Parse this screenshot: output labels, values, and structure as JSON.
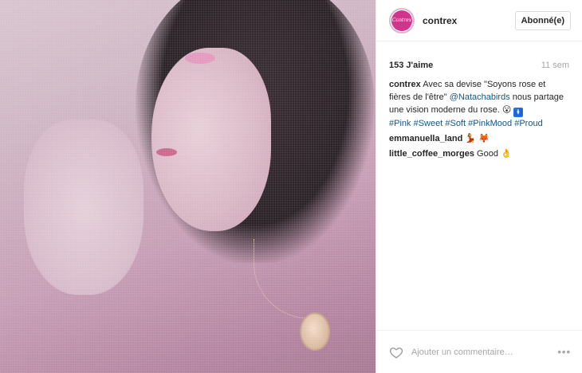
{
  "account": {
    "username": "contrex",
    "avatar_text": "Contrex",
    "follow_label": "Abonné(e)"
  },
  "post": {
    "likes": "153 J'aime",
    "age": "11 sem"
  },
  "caption": {
    "user": "contrex",
    "text_before_mention": "Avec sa devise \"Soyons rose et fières de l'être\"",
    "mention": "@Natachabirds",
    "text_after_mention": "nous partage une vision moderne du rose.",
    "emoji_1": "😮",
    "emoji_2_icon": "restroom-woman-icon",
    "emoji_2_char": "🚺",
    "hashtags": [
      "#Pink",
      "#Sweet",
      "#Soft",
      "#PinkMood",
      "#Proud"
    ]
  },
  "comments": [
    {
      "user": "emmanuella_land",
      "text": "",
      "emojis": [
        "💃",
        "🦊"
      ]
    },
    {
      "user": "little_coffee_morges",
      "text": "Good",
      "emojis": [
        "👌"
      ]
    }
  ],
  "footer": {
    "comment_placeholder": "Ajouter un commentaire…",
    "more_label": "•••"
  },
  "colors": {
    "link": "#125688",
    "brand_pink": "#d0358d",
    "muted": "#a5a7aa",
    "border": "#efefef"
  }
}
